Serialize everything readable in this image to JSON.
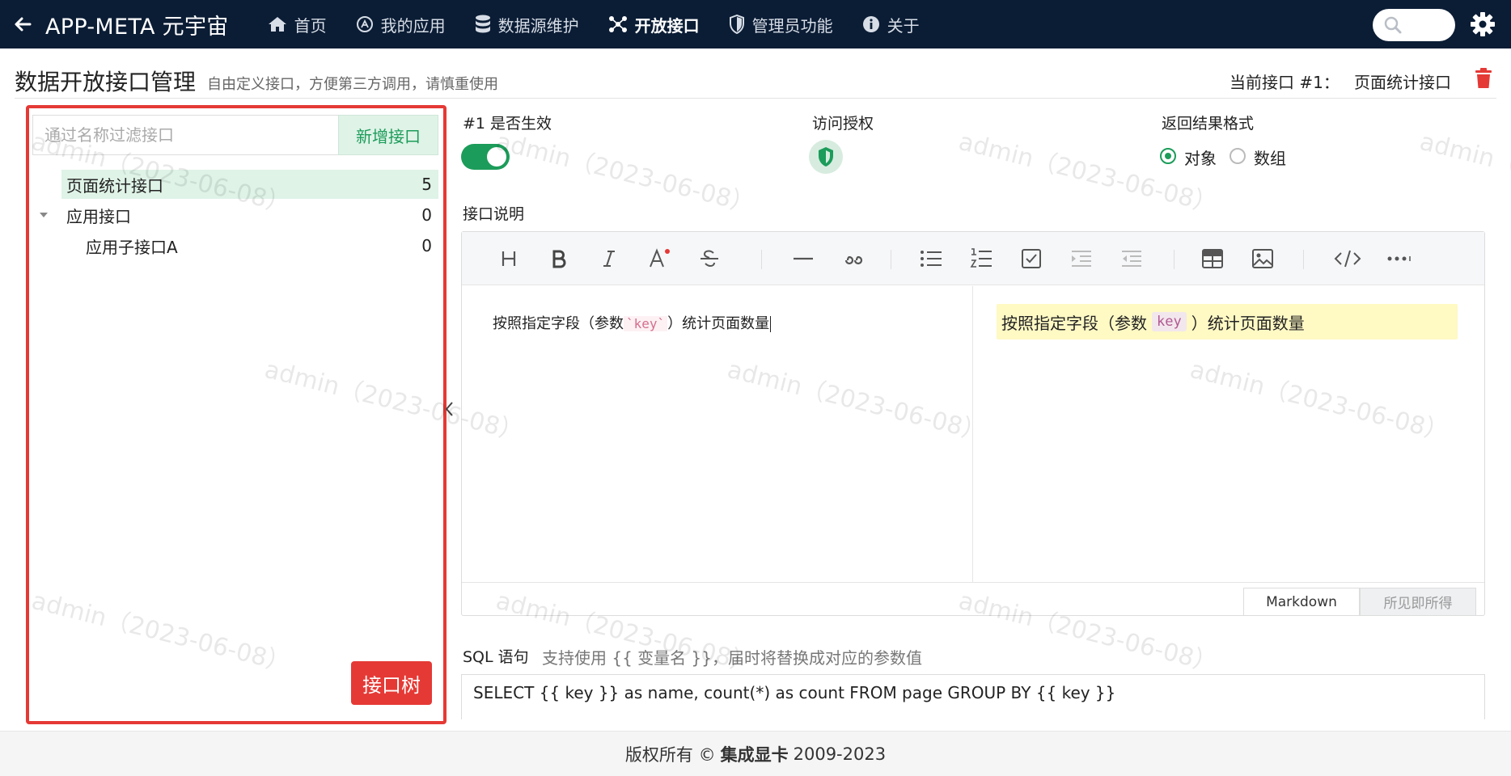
{
  "nav": {
    "brand": "APP-META 元宇宙",
    "items": [
      {
        "label": "首页",
        "icon": "home-icon"
      },
      {
        "label": "我的应用",
        "icon": "app-store-icon"
      },
      {
        "label": "数据源维护",
        "icon": "database-icon"
      },
      {
        "label": "开放接口",
        "icon": "nodes-icon",
        "active": true
      },
      {
        "label": "管理员功能",
        "icon": "shield-icon"
      },
      {
        "label": "关于",
        "icon": "info-icon"
      }
    ]
  },
  "page": {
    "title": "数据开放接口管理",
    "subtitle": "自由定义接口，方便第三方调用，请慎重使用",
    "current_label": "当前接口 #1：",
    "current_name": "页面统计接口"
  },
  "tree": {
    "filter_placeholder": "通过名称过滤接口",
    "add_label": "新增接口",
    "items": [
      {
        "label": "页面统计接口",
        "count": "5",
        "selected": true
      },
      {
        "label": "应用接口",
        "count": "0",
        "expanded": true
      },
      {
        "label": "应用子接口A",
        "count": "0"
      }
    ],
    "tree_button": "接口树"
  },
  "settings": {
    "enabled_label": "#1 是否生效",
    "enabled": true,
    "auth_label": "访问授权",
    "format_label": "返回结果格式",
    "format_options": [
      "对象",
      "数组"
    ],
    "format_selected": "对象"
  },
  "editor": {
    "label": "接口说明",
    "markdown": {
      "before": "按照指定字段（参数",
      "code": "`key`",
      "after": "）统计页面数量"
    },
    "preview": {
      "before": "按照指定字段（参数",
      "code": "key",
      "after": "）统计页面数量"
    },
    "mode_markdown": "Markdown",
    "mode_wysiwyg": "所见即所得"
  },
  "sql": {
    "label": "SQL 语句",
    "hint": "支持使用 {{ 变量名 }}，届时将替换成对应的参数值",
    "value": "SELECT {{ key }} as name, count(*) as count FROM page GROUP BY {{ key }}"
  },
  "footer": {
    "prefix": "版权所有 ©",
    "company": "集成显卡",
    "years": "2009-2023"
  },
  "watermark": "admin（2023-06-08）",
  "colors": {
    "nav_bg": "#0b1d35",
    "accent": "#1c9c5a",
    "danger": "#e53935"
  }
}
